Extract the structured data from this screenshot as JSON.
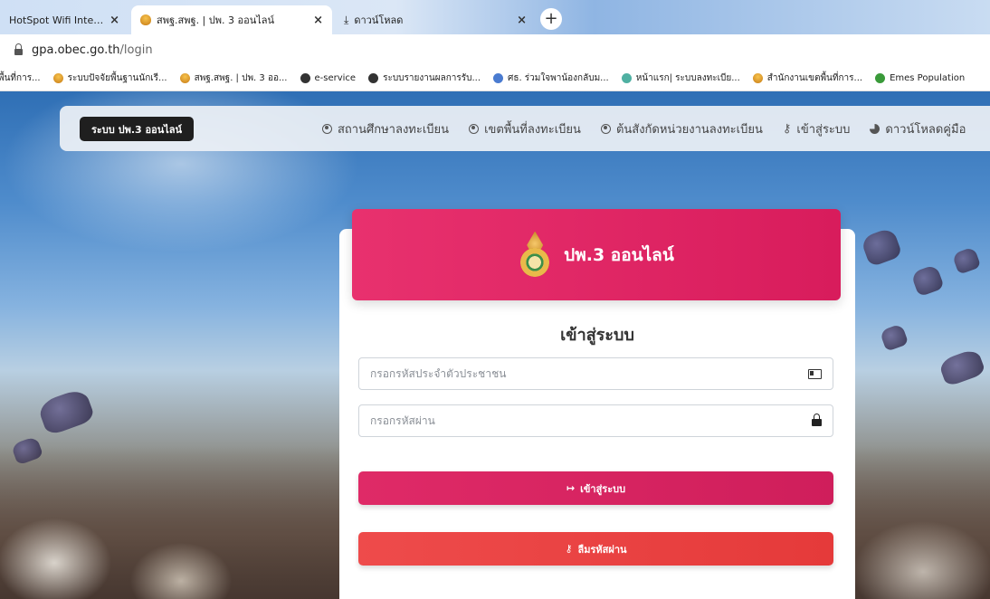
{
  "browser": {
    "tabs": [
      {
        "title": "HotSpot Wifi Internet",
        "close": "×",
        "active": false
      },
      {
        "title": "สพฐ.สพฐ. | ปพ. 3 ออนไลน์",
        "close": "×",
        "active": true
      },
      {
        "title": "ดาวน์โหลด",
        "close": "×",
        "active": false
      }
    ],
    "new_tab": "+",
    "url_host": "gpa.obec.go.th",
    "url_path": "/login",
    "bookmarks": [
      {
        "label": "พื้นที่การ...",
        "icon": "none"
      },
      {
        "label": "ระบบปัจจัยพื้นฐานนักเรี...",
        "icon": "gold"
      },
      {
        "label": "สพฐ.สพฐ. | ปพ. 3 ออ...",
        "icon": "gold"
      },
      {
        "label": "e-service",
        "icon": "globe"
      },
      {
        "label": "ระบบรายงานผลการรับ...",
        "icon": "globe"
      },
      {
        "label": "ศธ. ร่วมใจพาน้องกลับม...",
        "icon": "blue"
      },
      {
        "label": "หน้าแรก| ระบบลงทะเบีย...",
        "icon": "teal"
      },
      {
        "label": "สำนักงานเขตพื้นที่การ...",
        "icon": "gold"
      },
      {
        "label": "Emes Population",
        "icon": "green"
      }
    ]
  },
  "navbar": {
    "brand": "ระบบ ปพ.3 ออนไลน์",
    "links": [
      {
        "label": "สถานศึกษาลงทะเบียน",
        "icon": "user-circle-icon"
      },
      {
        "label": "เขตพื้นที่ลงทะเบียน",
        "icon": "user-circle-icon"
      },
      {
        "label": "ต้นสังกัดหน่วยงานลงทะเบียน",
        "icon": "user-circle-icon"
      },
      {
        "label": "เข้าสู่ระบบ",
        "icon": "key-icon"
      },
      {
        "label": "ดาวน์โหลดคู่มือ",
        "icon": "pie-chart-icon"
      }
    ]
  },
  "login": {
    "header_title": "ปพ.3 ออนไลน์",
    "title": "เข้าสู่ระบบ",
    "id_placeholder": "กรอกรหัสประจำตัวประชาชน",
    "password_placeholder": "กรอกรหัสผ่าน",
    "login_button": "เข้าสู่ระบบ",
    "forgot_button": "ลืมรหัสผ่าน"
  },
  "colors": {
    "header": "#e0266a",
    "login_button": "#d8225f",
    "forgot_button": "#e94343"
  }
}
